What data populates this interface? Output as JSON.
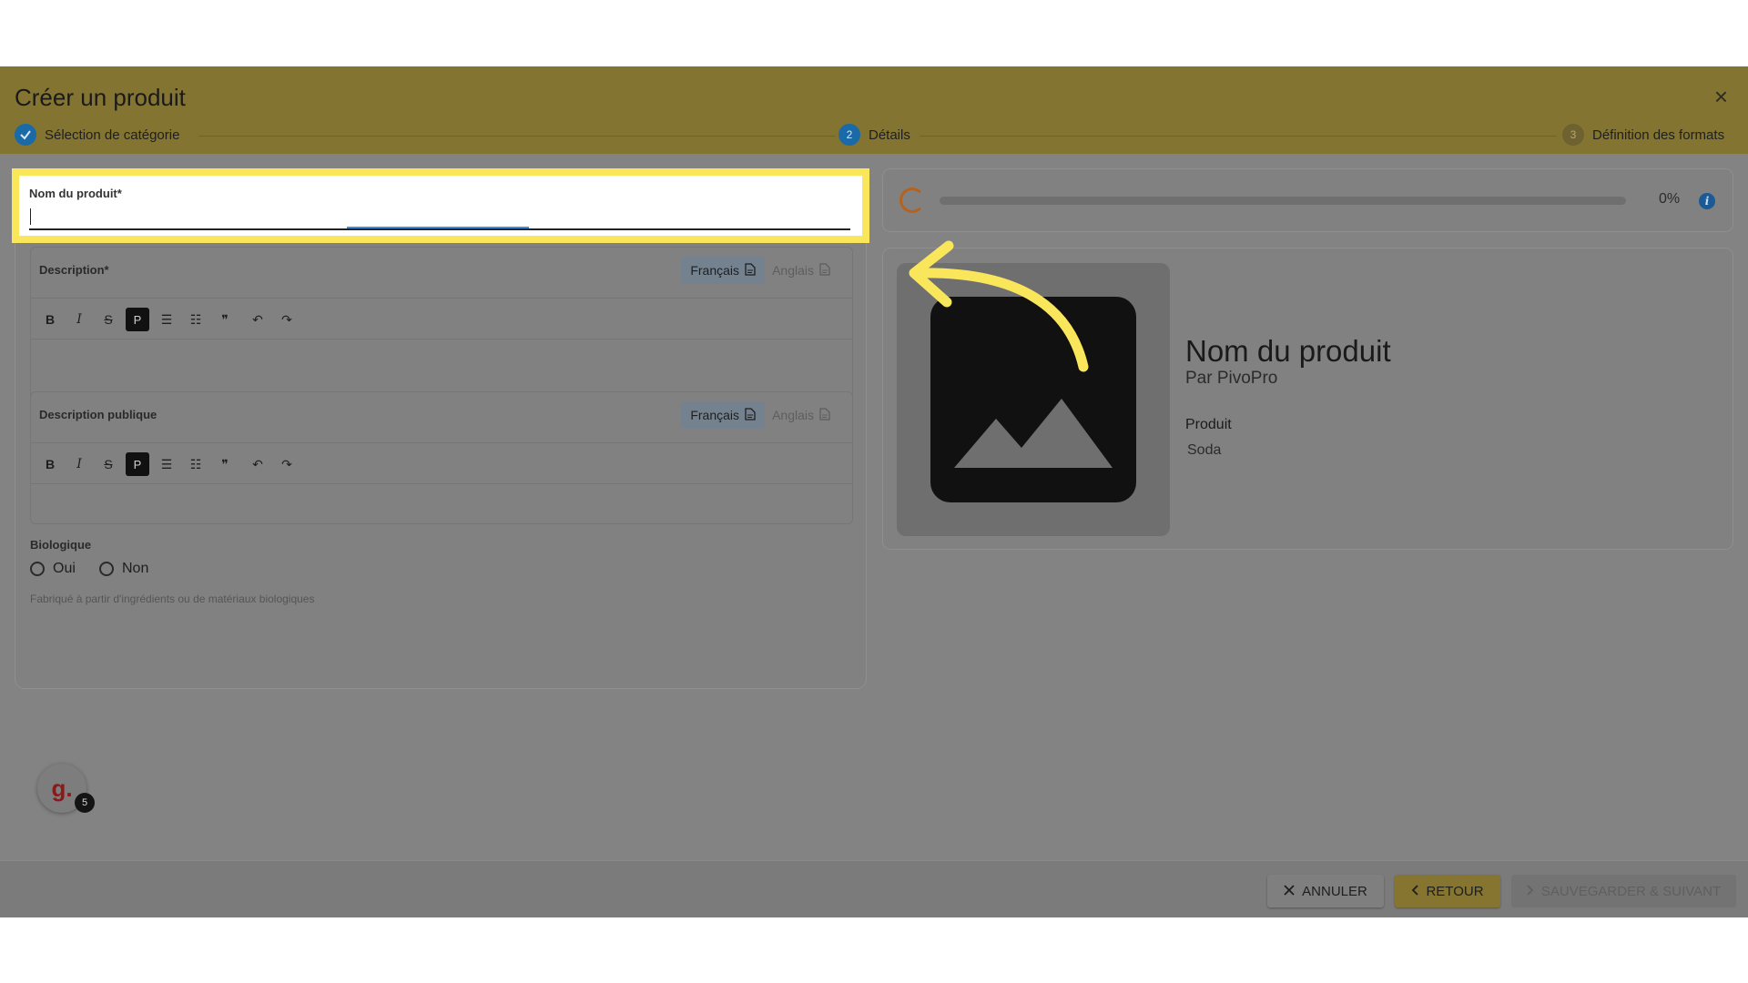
{
  "header": {
    "title": "Créer un produit",
    "close_icon": "×",
    "steps": [
      {
        "number": "✓",
        "label": "Sélection de catégorie"
      },
      {
        "number": "2",
        "label": "Détails"
      },
      {
        "number": "3",
        "label": "Définition des formats"
      }
    ]
  },
  "form": {
    "name_label": "Nom du produit*",
    "name_value": "",
    "description": {
      "label": "Description*",
      "lang_fr": "Français",
      "lang_en": "Anglais",
      "toolbar": {
        "bold": "B",
        "italic": "I",
        "strike": "S",
        "paragraph": "P",
        "bullets": "☰",
        "numbered": "☷",
        "quote": "❞",
        "undo": "↶",
        "redo": "↷"
      }
    },
    "public_description": {
      "label": "Description publique",
      "lang_fr": "Français",
      "lang_en": "Anglais"
    },
    "organic": {
      "label": "Biologique",
      "yes": "Oui",
      "no": "Non",
      "help": "Fabriqué à partir d'ingrédients ou de matériaux biologiques"
    }
  },
  "progress": {
    "value": 0,
    "text": "0%",
    "info_icon": "i"
  },
  "preview": {
    "name": "Nom du produit",
    "by": "Par PivoPro",
    "type_label": "Produit",
    "type_value": "Soda"
  },
  "footer": {
    "cancel": "ANNULER",
    "back": "RETOUR",
    "save_next": "SAUVEGARDER & SUIVANT"
  },
  "assistant": {
    "letter": "g.",
    "badge": "5"
  },
  "colors": {
    "accent": "#1a6aa8",
    "highlight": "#f9e65a",
    "header": "#837431"
  }
}
